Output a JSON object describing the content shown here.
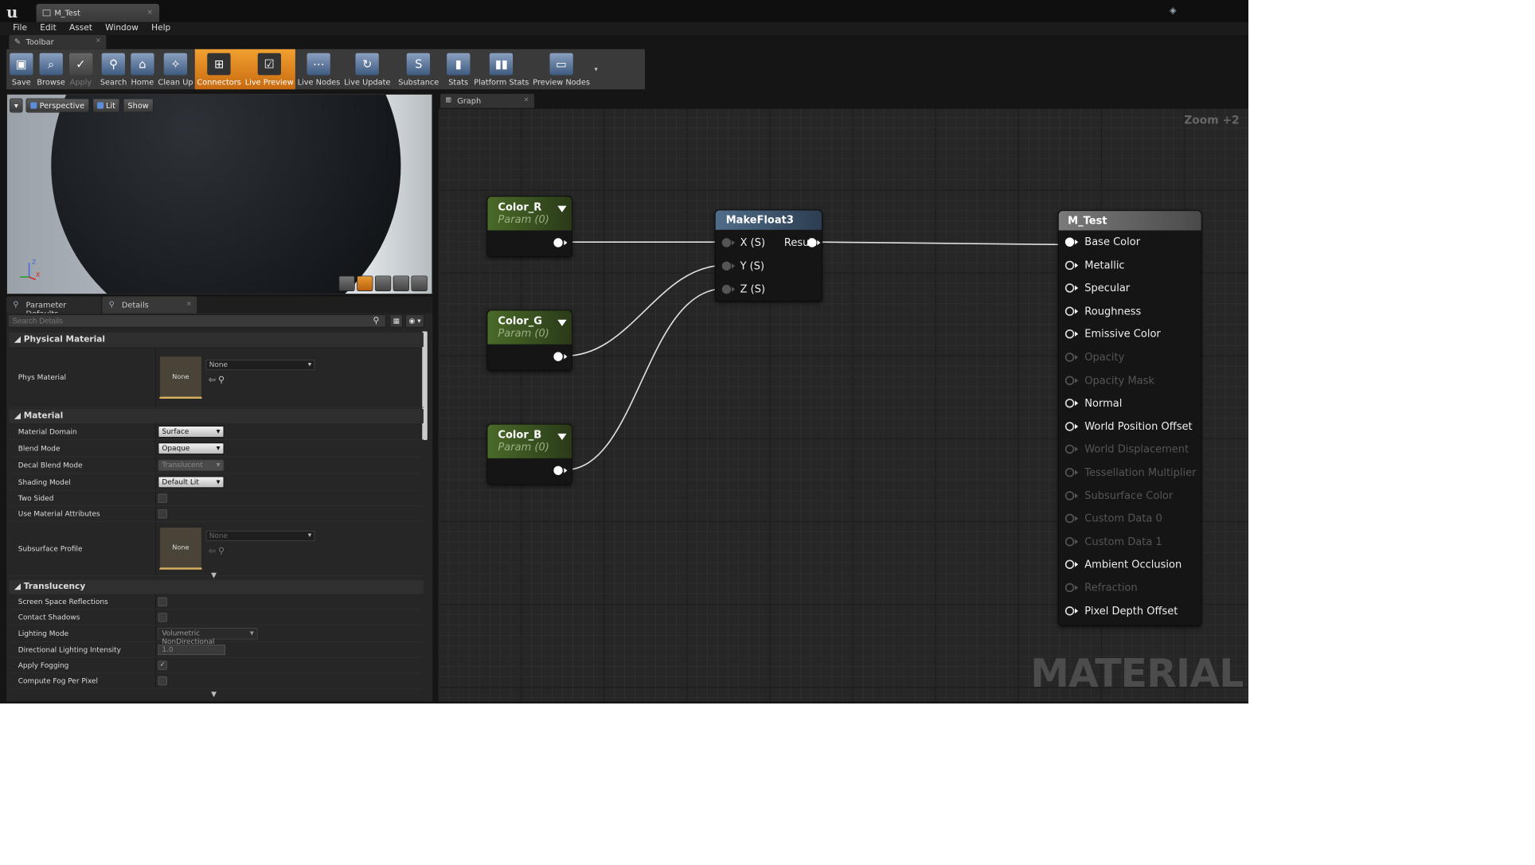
{
  "window": {
    "tab_title": "M_Test",
    "close_symbol": "×",
    "controls": [
      "▁",
      "❐",
      "✕"
    ]
  },
  "menu": [
    "File",
    "Edit",
    "Asset",
    "Window",
    "Help"
  ],
  "toolbar_tab": {
    "label": "Toolbar"
  },
  "toolbar": {
    "buttons": [
      {
        "label": "Save",
        "icon": "save-icon",
        "state": "normal"
      },
      {
        "label": "Browse",
        "icon": "browse-icon",
        "state": "normal"
      },
      {
        "label": "Apply",
        "icon": "apply-icon",
        "state": "disabled"
      },
      {
        "label": "Search",
        "icon": "search-icon",
        "state": "normal"
      },
      {
        "label": "Home",
        "icon": "home-icon",
        "state": "normal"
      },
      {
        "label": "Clean Up",
        "icon": "clean-up-icon",
        "state": "normal"
      },
      {
        "label": "Connectors",
        "icon": "connectors-icon",
        "state": "active"
      },
      {
        "label": "Live Preview",
        "icon": "live-preview-icon",
        "state": "active"
      },
      {
        "label": "Live Nodes",
        "icon": "live-nodes-icon",
        "state": "normal"
      },
      {
        "label": "Live Update",
        "icon": "live-update-icon",
        "state": "normal"
      },
      {
        "label": "Substance",
        "icon": "substance-icon",
        "state": "normal"
      },
      {
        "label": "Stats",
        "icon": "stats-icon",
        "state": "normal"
      },
      {
        "label": "Platform Stats",
        "icon": "platform-stats-icon",
        "state": "normal"
      },
      {
        "label": "Preview Nodes",
        "icon": "preview-nodes-icon",
        "state": "normal"
      }
    ]
  },
  "viewport": {
    "perspective": "Perspective",
    "lit": "Lit",
    "show": "Show",
    "axis_z": "Z",
    "axis_x": "X"
  },
  "panel_tabs": [
    "Parameter Defaults",
    "Details"
  ],
  "details": {
    "search_placeholder": "Search Details",
    "physical_material": {
      "title": "Physical Material",
      "phys_material_label": "Phys Material",
      "thumb": "None",
      "value": "None"
    },
    "material": {
      "title": "Material",
      "rows": [
        {
          "label": "Material Domain",
          "value": "Surface"
        },
        {
          "label": "Blend Mode",
          "value": "Opaque"
        },
        {
          "label": "Decal Blend Mode",
          "value": "Translucent"
        },
        {
          "label": "Shading Model",
          "value": "Default Lit"
        },
        {
          "label": "Two Sided",
          "value": ""
        },
        {
          "label": "Use Material Attributes",
          "value": ""
        }
      ],
      "subsurface_label": "Subsurface Profile",
      "subsurface_thumb": "None",
      "subsurface_value": "None"
    },
    "translucency": {
      "title": "Translucency",
      "rows": [
        {
          "label": "Screen Space Reflections"
        },
        {
          "label": "Contact Shadows"
        },
        {
          "label": "Lighting Mode",
          "value": "Volumetric NonDirectional"
        },
        {
          "label": "Directional Lighting Intensity",
          "value": "1.0"
        },
        {
          "label": "Apply Fogging",
          "checked": true
        },
        {
          "label": "Compute Fog Per Pixel"
        }
      ]
    }
  },
  "graph": {
    "tab": "Graph",
    "zoom": "Zoom +2",
    "watermark": "MATERIAL",
    "params": [
      {
        "name": "Color_R",
        "sub": "Param (0)"
      },
      {
        "name": "Color_G",
        "sub": "Param (0)"
      },
      {
        "name": "Color_B",
        "sub": "Param (0)"
      }
    ],
    "makefloat": {
      "title": "MakeFloat3",
      "inputs": [
        "X (S)",
        "Y (S)",
        "Z (S)"
      ],
      "output": "Result"
    },
    "result": {
      "title": "M_Test",
      "pins": [
        {
          "label": "Base Color",
          "enabled": true,
          "connected": true
        },
        {
          "label": "Metallic",
          "enabled": true
        },
        {
          "label": "Specular",
          "enabled": true
        },
        {
          "label": "Roughness",
          "enabled": true
        },
        {
          "label": "Emissive Color",
          "enabled": true
        },
        {
          "label": "Opacity",
          "enabled": false
        },
        {
          "label": "Opacity Mask",
          "enabled": false
        },
        {
          "label": "Normal",
          "enabled": true
        },
        {
          "label": "World Position Offset",
          "enabled": true
        },
        {
          "label": "World Displacement",
          "enabled": false
        },
        {
          "label": "Tessellation Multiplier",
          "enabled": false
        },
        {
          "label": "Subsurface Color",
          "enabled": false
        },
        {
          "label": "Custom Data 0",
          "enabled": false
        },
        {
          "label": "Custom Data 1",
          "enabled": false
        },
        {
          "label": "Ambient Occlusion",
          "enabled": true
        },
        {
          "label": "Refraction",
          "enabled": false
        },
        {
          "label": "Pixel Depth Offset",
          "enabled": true
        }
      ]
    }
  }
}
